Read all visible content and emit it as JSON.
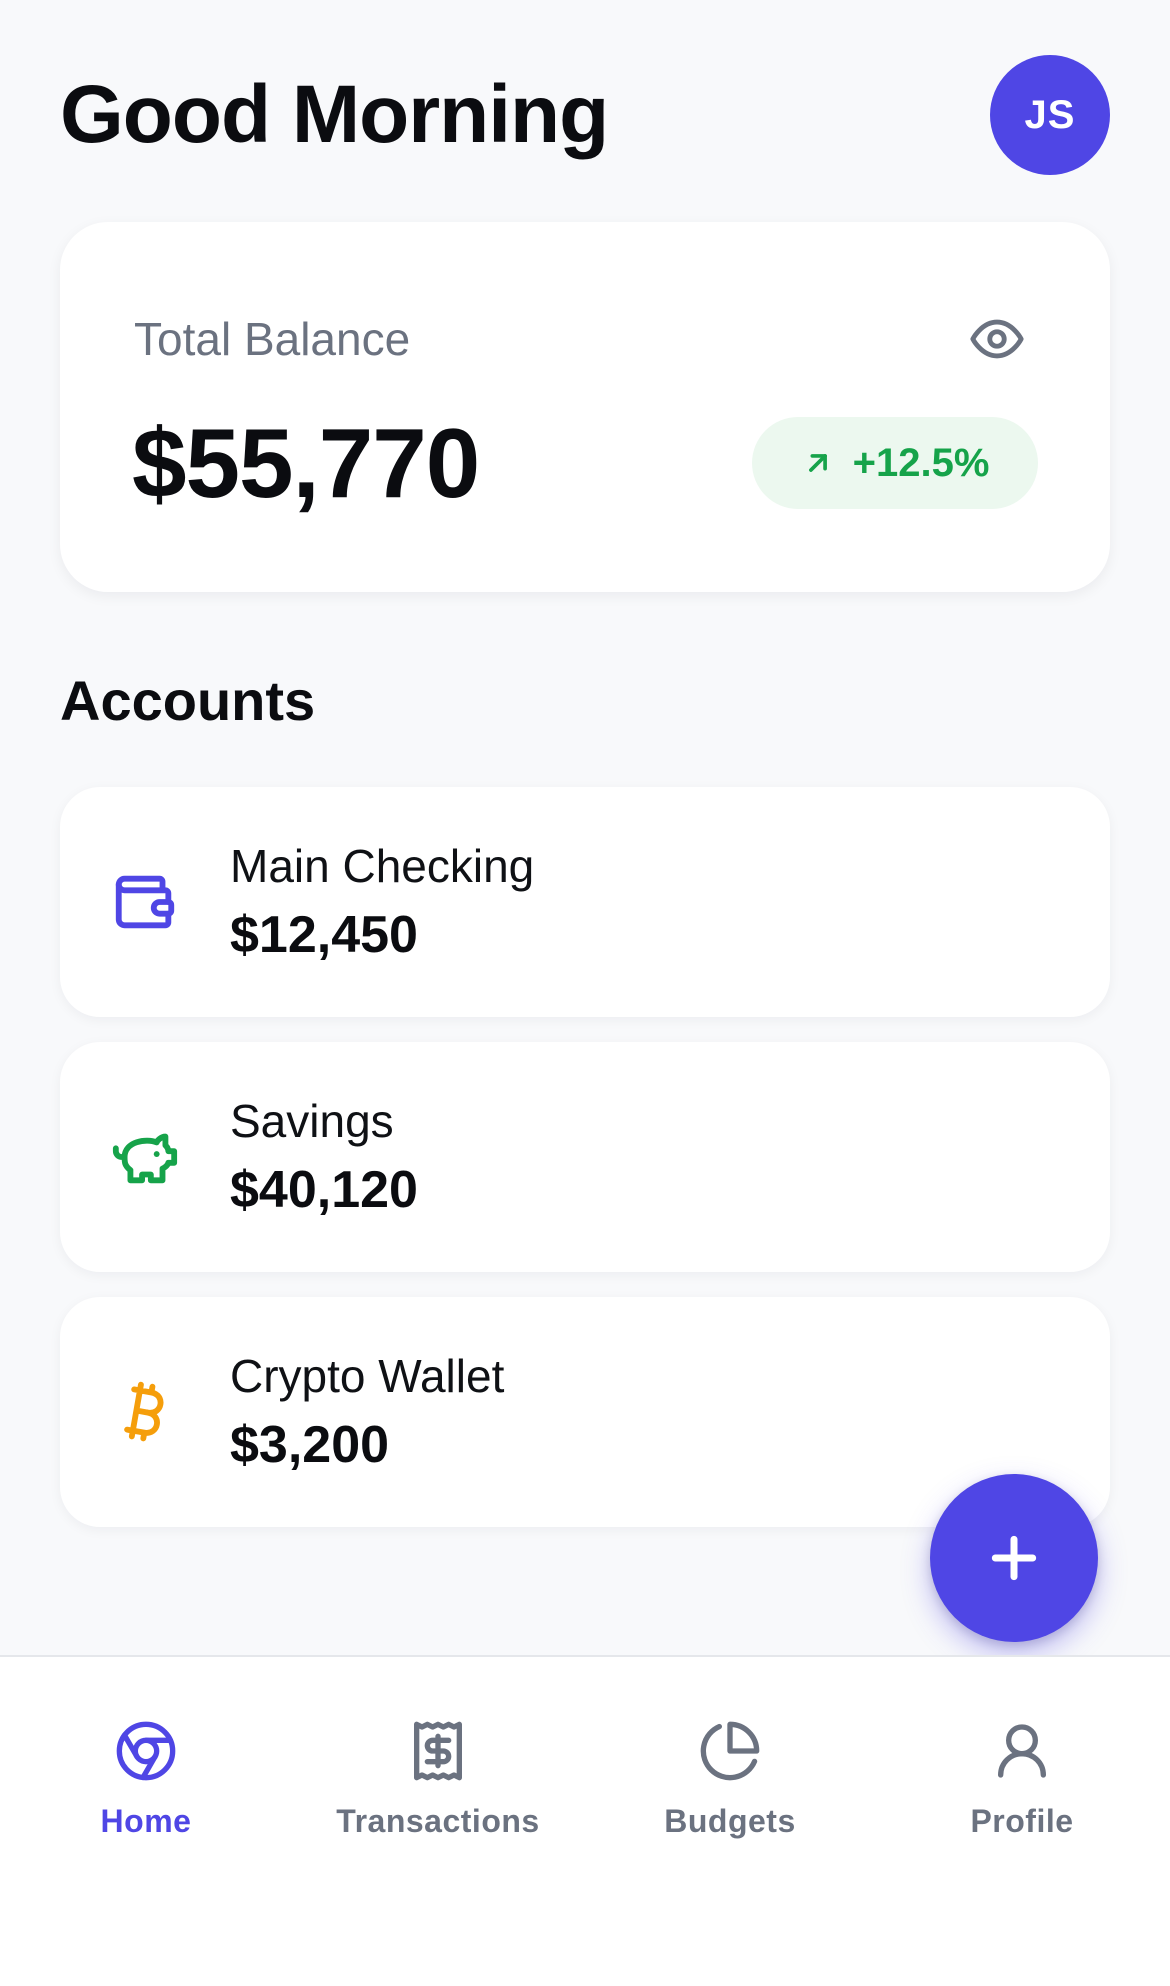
{
  "header": {
    "greeting": "Good Morning",
    "avatar_initials": "JS"
  },
  "balance": {
    "label": "Total Balance",
    "amount": "$55,770",
    "trend": "+12.5%",
    "visibility_icon": "eye-icon",
    "trend_icon": "arrow-up-right-icon"
  },
  "accounts": {
    "title": "Accounts",
    "items": [
      {
        "name": "Main Checking",
        "balance": "$12,450",
        "icon": "wallet-icon",
        "color": "#4f46e5"
      },
      {
        "name": "Savings",
        "balance": "$40,120",
        "icon": "piggy-bank-icon",
        "color": "#16a34a"
      },
      {
        "name": "Crypto Wallet",
        "balance": "$3,200",
        "icon": "bitcoin-icon",
        "color": "#f59e0b"
      }
    ]
  },
  "fab": {
    "icon": "plus-icon"
  },
  "nav": {
    "items": [
      {
        "label": "Home",
        "icon": "home-icon",
        "active": true
      },
      {
        "label": "Transactions",
        "icon": "receipt-icon",
        "active": false
      },
      {
        "label": "Budgets",
        "icon": "pie-chart-icon",
        "active": false
      },
      {
        "label": "Profile",
        "icon": "user-icon",
        "active": false
      }
    ]
  },
  "colors": {
    "accent": "#4f46e5",
    "success": "#16a34a",
    "success_bg": "#ecf8ef",
    "muted": "#6b7280",
    "background": "#f8f9fb"
  }
}
